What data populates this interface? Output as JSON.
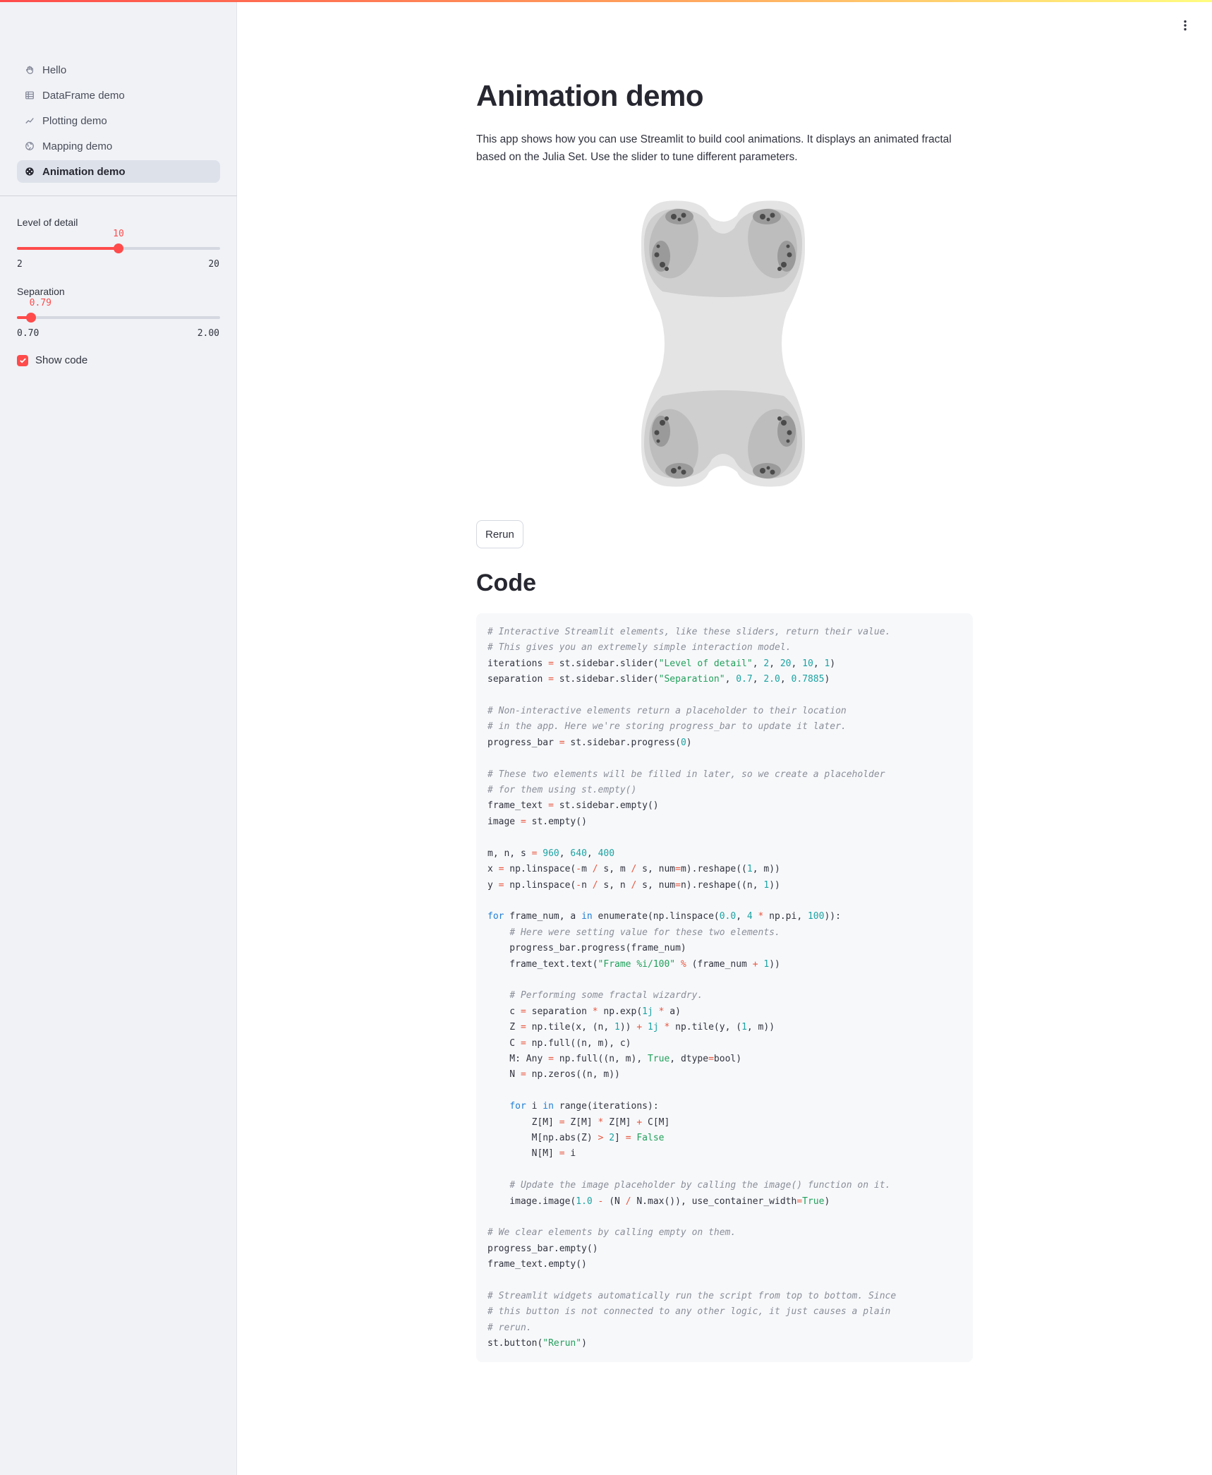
{
  "sidebar": {
    "nav": [
      {
        "label": "Hello",
        "icon": "hand-wave-icon",
        "active": false
      },
      {
        "label": "DataFrame demo",
        "icon": "table-icon",
        "active": false
      },
      {
        "label": "Plotting demo",
        "icon": "chart-line-icon",
        "active": false
      },
      {
        "label": "Mapping demo",
        "icon": "globe-icon",
        "active": false
      },
      {
        "label": "Animation demo",
        "icon": "film-icon",
        "active": true
      }
    ],
    "level_of_detail": {
      "label": "Level of detail",
      "value": "10",
      "min": "2",
      "max": "20",
      "fraction": 0.5
    },
    "separation": {
      "label": "Separation",
      "value": "0.79",
      "min": "0.70",
      "max": "2.00",
      "fraction": 0.0683
    },
    "show_code": {
      "label": "Show code",
      "checked": true
    }
  },
  "main": {
    "title": "Animation demo",
    "intro": "This app shows how you can use Streamlit to build cool animations. It displays an animated fractal based on the Julia Set. Use the slider to tune different parameters.",
    "rerun_label": "Rerun",
    "code_heading": "Code",
    "code_lines": [
      "# Interactive Streamlit elements, like these sliders, return their value.",
      "# This gives you an extremely simple interaction model.",
      "iterations = st.sidebar.slider(\"Level of detail\", 2, 20, 10, 1)",
      "separation = st.sidebar.slider(\"Separation\", 0.7, 2.0, 0.7885)",
      "",
      "# Non-interactive elements return a placeholder to their location",
      "# in the app. Here we're storing progress_bar to update it later.",
      "progress_bar = st.sidebar.progress(0)",
      "",
      "# These two elements will be filled in later, so we create a placeholder",
      "# for them using st.empty()",
      "frame_text = st.sidebar.empty()",
      "image = st.empty()",
      "",
      "m, n, s = 960, 640, 400",
      "x = np.linspace(-m / s, m / s, num=m).reshape((1, m))",
      "y = np.linspace(-n / s, n / s, num=n).reshape((n, 1))",
      "",
      "for frame_num, a in enumerate(np.linspace(0.0, 4 * np.pi, 100)):",
      "    # Here were setting value for these two elements.",
      "    progress_bar.progress(frame_num)",
      "    frame_text.text(\"Frame %i/100\" % (frame_num + 1))",
      "",
      "    # Performing some fractal wizardry.",
      "    c = separation * np.exp(1j * a)",
      "    Z = np.tile(x, (n, 1)) + 1j * np.tile(y, (1, m))",
      "    C = np.full((n, m), c)",
      "    M: Any = np.full((n, m), True, dtype=bool)",
      "    N = np.zeros((n, m))",
      "",
      "    for i in range(iterations):",
      "        Z[M] = Z[M] * Z[M] + C[M]",
      "        M[np.abs(Z) > 2] = False",
      "        N[M] = i",
      "",
      "    # Update the image placeholder by calling the image() function on it.",
      "    image.image(1.0 - (N / N.max()), use_container_width=True)",
      "",
      "# We clear elements by calling empty on them.",
      "progress_bar.empty()",
      "frame_text.empty()",
      "",
      "# Streamlit widgets automatically run the script from top to bottom. Since",
      "# this button is not connected to any other logic, it just causes a plain",
      "# rerun.",
      "st.button(\"Rerun\")"
    ]
  },
  "colors": {
    "accent": "#ff4b4b",
    "sidebar_bg": "#f0f2f6",
    "code_bg": "#f7f8fa",
    "string": "#21a05b",
    "number": "#1ca3a3",
    "keyword": "#1f7ed6",
    "operator": "#e8563f",
    "comment": "#8a8e99"
  }
}
